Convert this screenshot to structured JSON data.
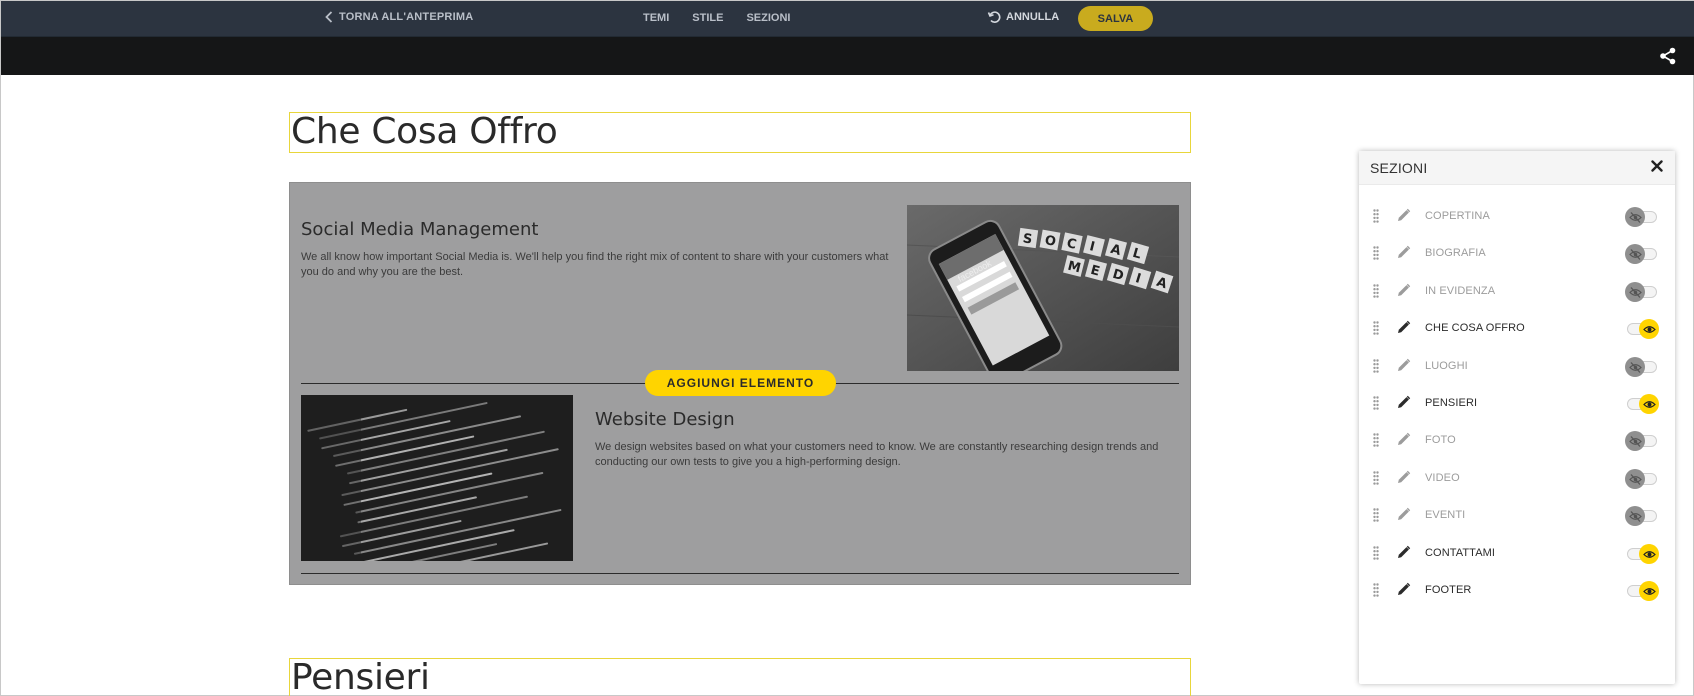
{
  "topbar": {
    "back_label": "TORNA ALL'ANTEPRIMA",
    "nav": [
      "TEMI",
      "STILE",
      "SEZIONI"
    ],
    "undo_label": "ANNULLA",
    "save_label": "SALVA"
  },
  "content": {
    "section1_title": "Che Cosa Offro",
    "items": [
      {
        "title": "Social Media Management",
        "text": "We all know how important Social Media is. We'll help you find the right mix of content to share with your customers what you do and why you are the best."
      },
      {
        "title": "Website Design",
        "text": "We design websites based on what your customers need to know. We are constantly researching design trends and conducting our own tests to give you a high-performing design."
      }
    ],
    "add_element_label": "AGGIUNGI ELEMENTO",
    "section2_title": "Pensieri",
    "phone_screen_text": "facebook",
    "tiles_row1": [
      "S",
      "O",
      "C",
      "I",
      "A",
      "L"
    ],
    "tiles_row2": [
      "M",
      "E",
      "D",
      "I",
      "A"
    ]
  },
  "panel": {
    "title": "SEZIONI",
    "sections": [
      {
        "label": "COPERTINA",
        "visible": false
      },
      {
        "label": "BIOGRAFIA",
        "visible": false
      },
      {
        "label": "IN EVIDENZA",
        "visible": false
      },
      {
        "label": "CHE COSA OFFRO",
        "visible": true
      },
      {
        "label": "LUOGHI",
        "visible": false
      },
      {
        "label": "PENSIERI",
        "visible": true
      },
      {
        "label": "FOTO",
        "visible": false
      },
      {
        "label": "VIDEO",
        "visible": false
      },
      {
        "label": "EVENTI",
        "visible": false
      },
      {
        "label": "CONTATTAMI",
        "visible": true
      },
      {
        "label": "FOOTER",
        "visible": true
      }
    ]
  },
  "colors": {
    "accent": "#ffd400",
    "save_button": "#c9ab1e",
    "topbar": "#2c3440",
    "blackbar": "#151617"
  }
}
